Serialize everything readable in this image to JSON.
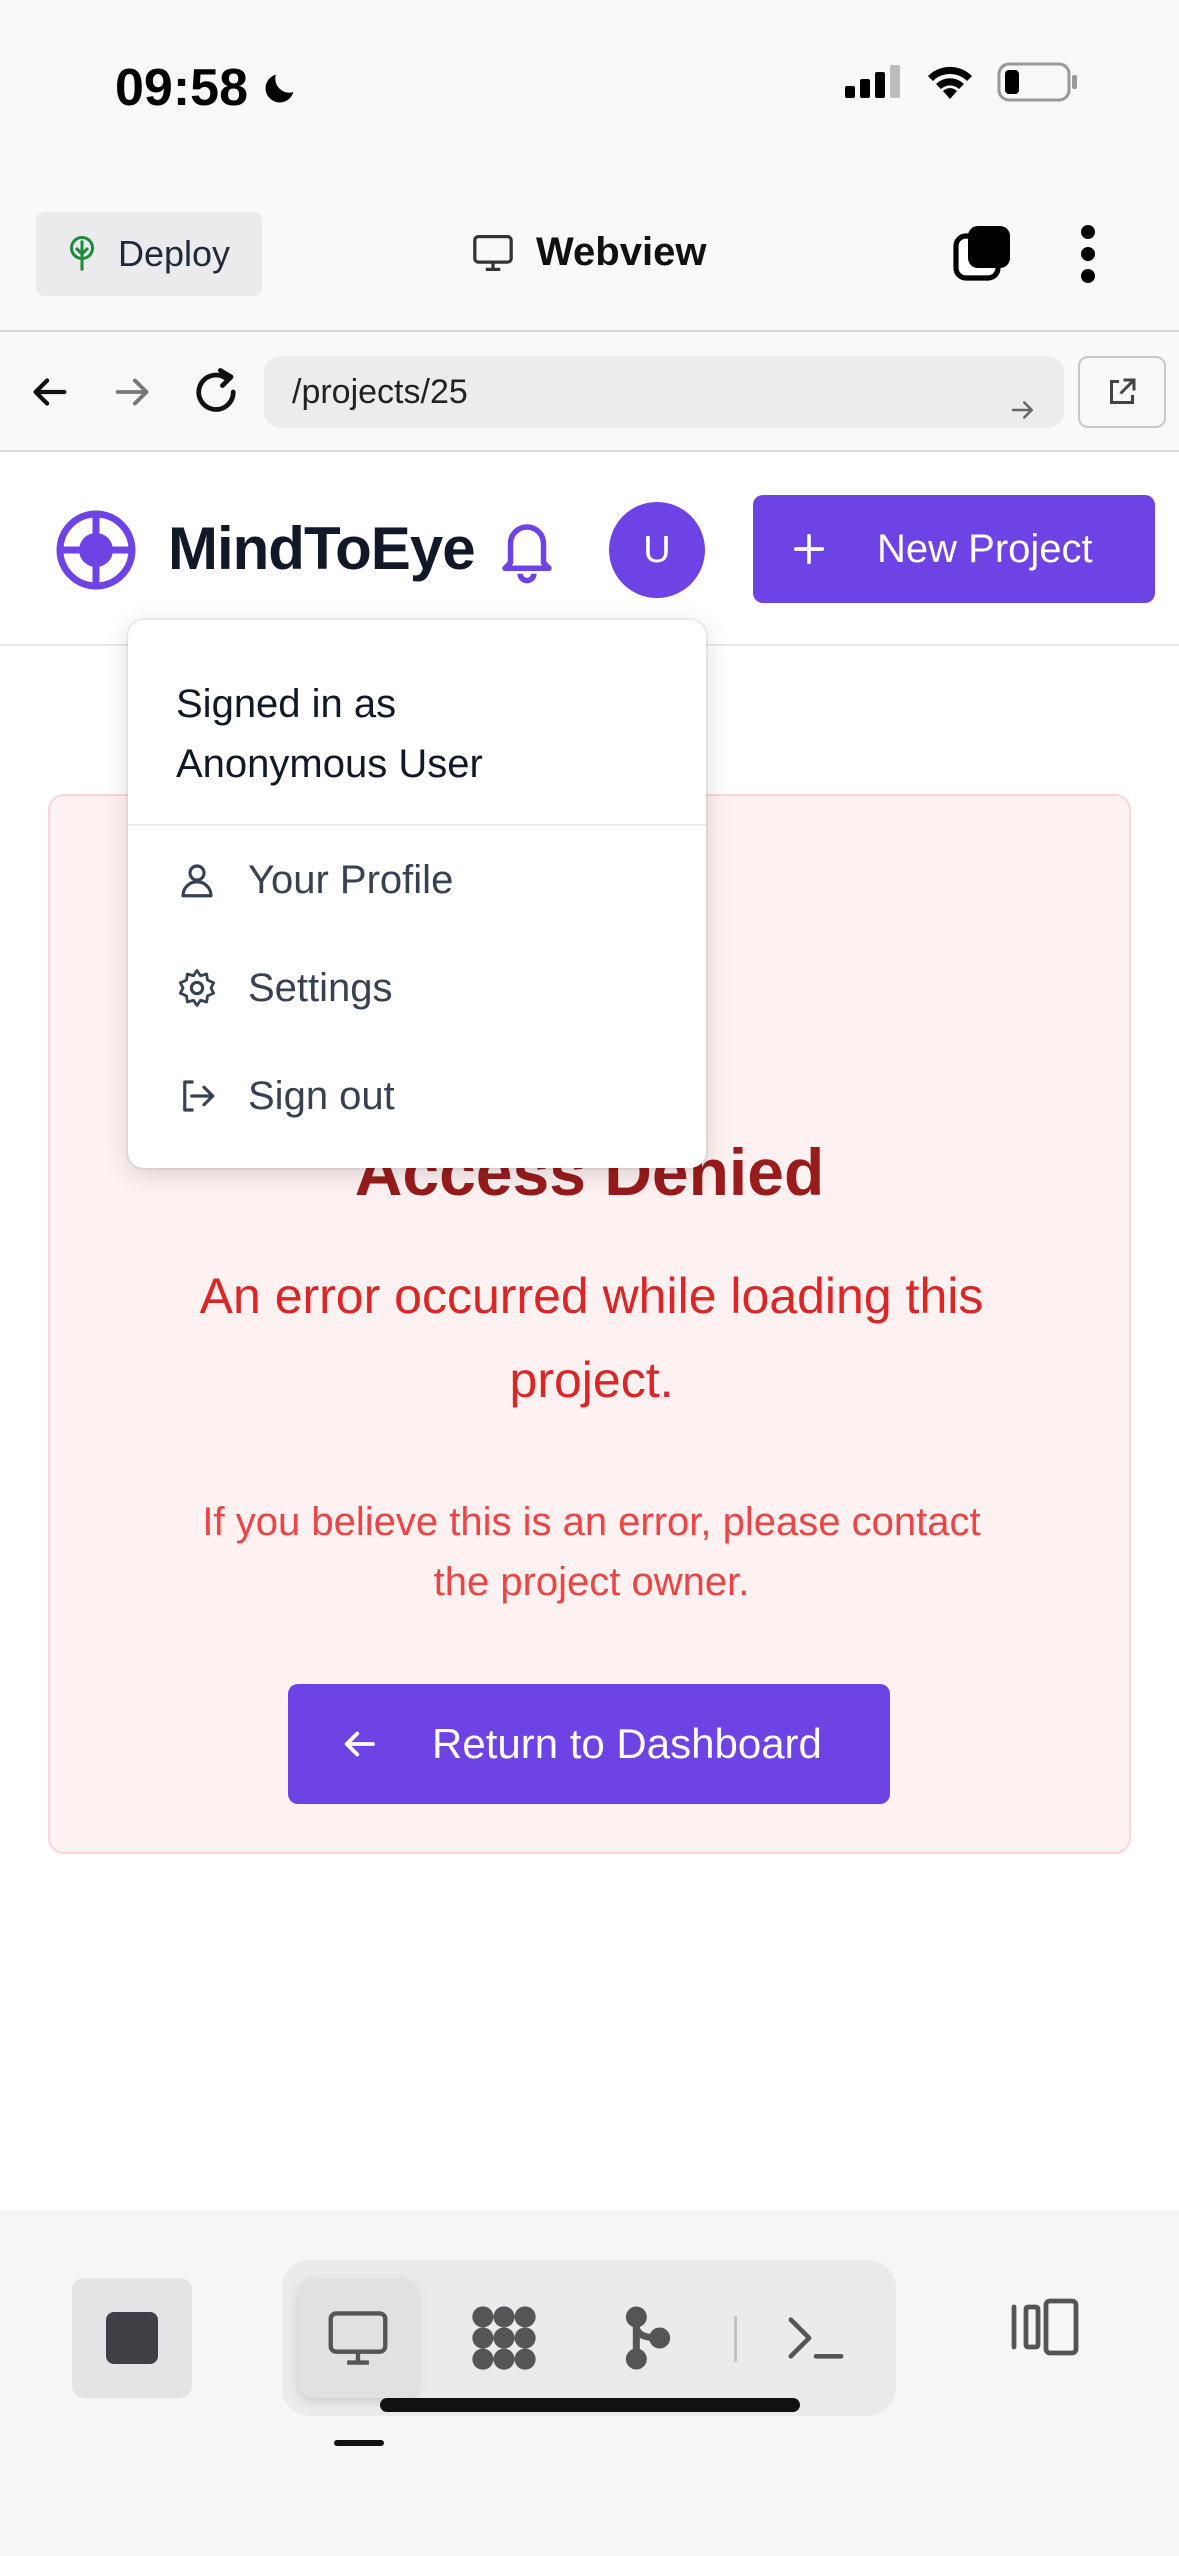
{
  "status_bar": {
    "time": "09:58"
  },
  "app_bar": {
    "deploy_label": "Deploy",
    "title": "Webview"
  },
  "url_bar": {
    "url": "/projects/25"
  },
  "site": {
    "brand": "MindToEye",
    "avatar_initial": "U",
    "new_project_label": "New Project",
    "accent_color": "#6d43e6"
  },
  "user_menu": {
    "signed_in_label": "Signed in as",
    "user_name": "Anonymous User",
    "items": [
      {
        "label": "Your Profile",
        "icon": "user-icon"
      },
      {
        "label": "Settings",
        "icon": "gear-icon"
      },
      {
        "label": "Sign out",
        "icon": "sign-out-icon"
      }
    ]
  },
  "error": {
    "title": "Access Denied",
    "message": "An error occurred while loading this project.",
    "hint": "If you believe this is an error, please contact the project owner.",
    "button_label": "Return to Dashboard"
  },
  "bottom_toolbar": {
    "tools": [
      "webview-icon",
      "packages-icon",
      "git-icon",
      "shell-icon"
    ],
    "active_tool": "webview-icon"
  }
}
